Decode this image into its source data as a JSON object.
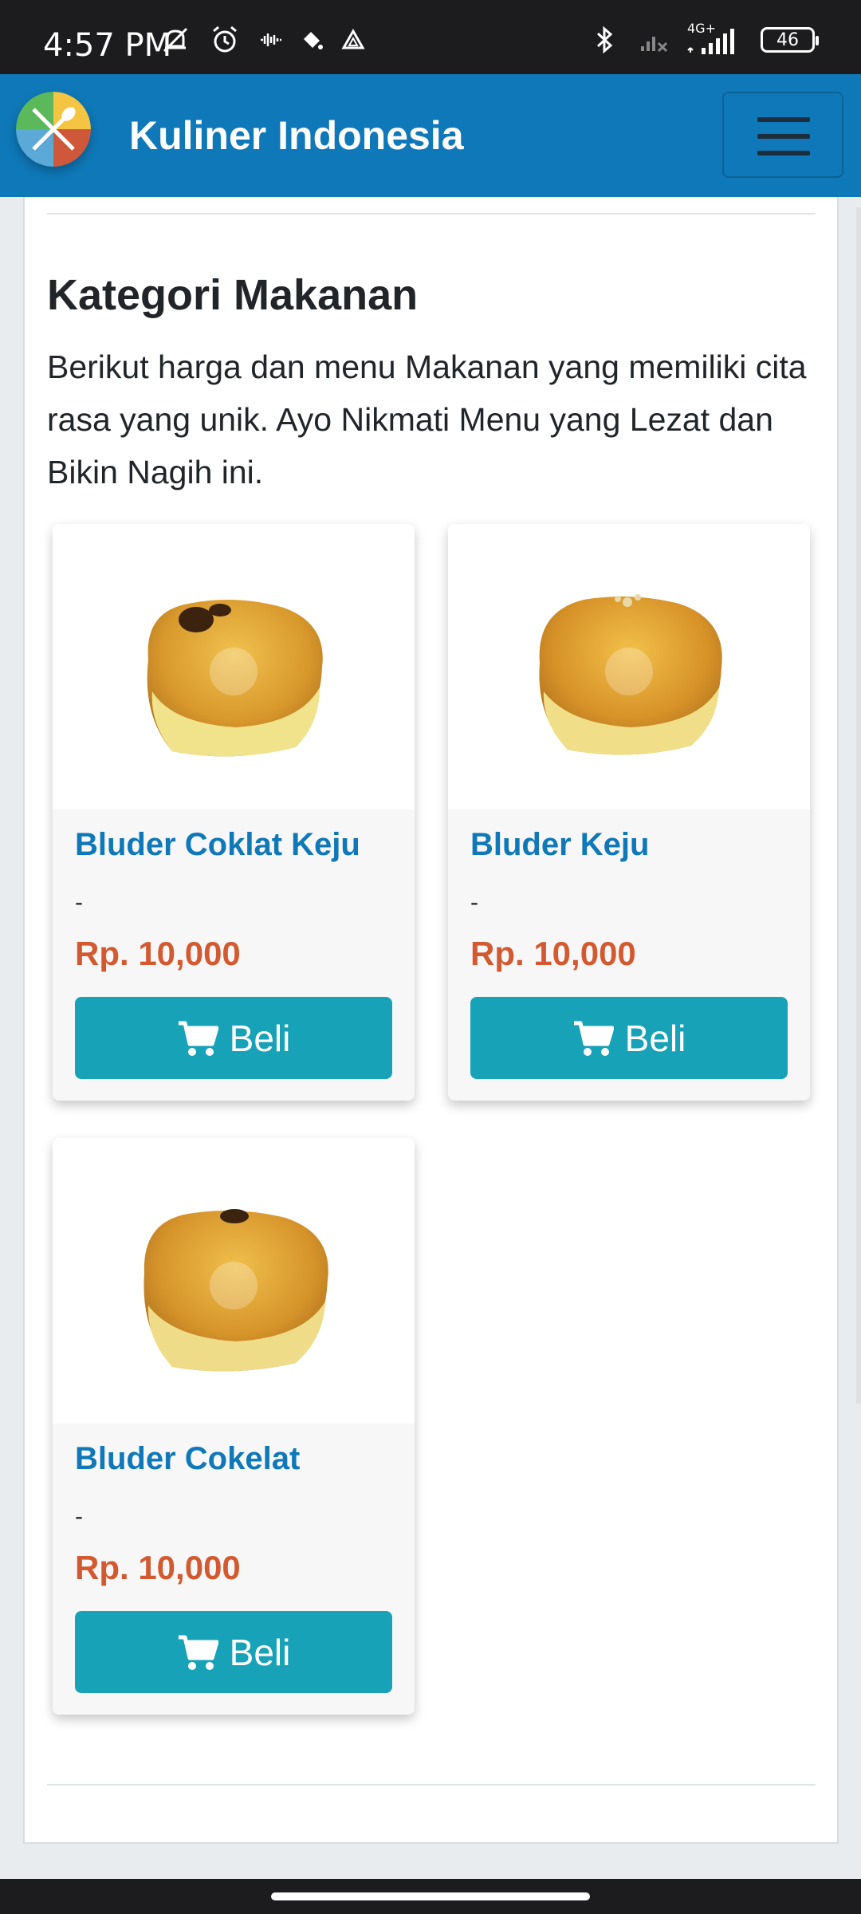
{
  "status_bar": {
    "time": "4:57 PM",
    "network": "4G+",
    "battery": "46",
    "icons": [
      "silent-icon",
      "alarm-icon",
      "sound-wave-icon",
      "paint-bucket-icon",
      "drive-icon",
      "bluetooth-icon",
      "signal-icon"
    ]
  },
  "navbar": {
    "brand": "Kuliner Indonesia",
    "logo_colors": [
      "#f4c542",
      "#5bb85b",
      "#5aa9d6",
      "#d0583a"
    ]
  },
  "section": {
    "title": "Kategori Makanan",
    "description": "Berikut harga dan menu Makanan yang memiliki cita rasa yang unik. Ayo Nikmati Menu yang Lezat dan Bikin Nagih ini."
  },
  "products": [
    {
      "name": "Bluder Coklat Keju",
      "desc": "-",
      "price": "Rp. 10,000",
      "button": "Beli"
    },
    {
      "name": "Bluder Keju",
      "desc": "-",
      "price": "Rp. 10,000",
      "button": "Beli"
    },
    {
      "name": "Bluder Cokelat",
      "desc": "-",
      "price": "Rp. 10,000",
      "button": "Beli"
    }
  ],
  "colors": {
    "primary": "#0f78b8",
    "price": "#d35a30",
    "button": "#17a2b8"
  }
}
